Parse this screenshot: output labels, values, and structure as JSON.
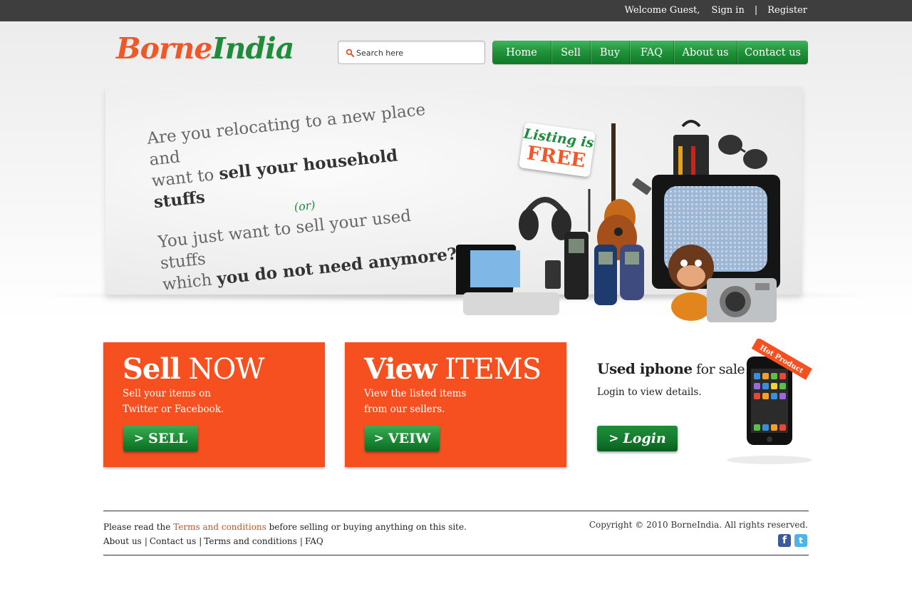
{
  "topbar": {
    "welcome": "Welcome Guest,",
    "signin": "Sign in",
    "separator": "|",
    "register": "Register"
  },
  "logo": {
    "part1": "Borne",
    "part2": "India"
  },
  "search": {
    "placeholder": "Search here"
  },
  "nav": {
    "items": [
      {
        "label": "Home"
      },
      {
        "label": "Sell"
      },
      {
        "label": "Buy"
      },
      {
        "label": "FAQ"
      },
      {
        "label": "About us"
      },
      {
        "label": "Contact us"
      }
    ]
  },
  "hero": {
    "line1": "Are you relocating to a new place and",
    "line2_plain": "want to ",
    "line2_bold": "sell your household stuffs",
    "or": "(or)",
    "line3": "You just want to sell your used stuffs",
    "line4_plain": "which ",
    "line4_bold": "you do not need anymore?",
    "badge_line1": "Listing is",
    "badge_line2": "FREE"
  },
  "sell_box": {
    "title_bold": "Sell",
    "title_rest": " NOW",
    "desc_line1": "Sell your items on",
    "desc_line2": "Twitter or Facebook.",
    "button": "SELL"
  },
  "view_box": {
    "title_bold": "View",
    "title_rest": " ITEMS",
    "desc_line1": "View the listed items",
    "desc_line2": "from our sellers.",
    "button": "VEIW"
  },
  "promo": {
    "title_bold": "Used iphone",
    "title_rest": " for sale!!",
    "desc": "Login to view details.",
    "button": "Login",
    "ribbon": "Hot Product"
  },
  "footer": {
    "notice_before": "Please read the ",
    "notice_link": "Terms and conditions",
    "notice_after": " before selling or buying anything on this site.",
    "links": [
      "About us",
      "Contact us",
      "Terms and conditions",
      "FAQ"
    ],
    "pipe": "|",
    "copyright": "Copyright © 2010 BorneIndia. All rights reserved."
  },
  "colors": {
    "orange": "#f65021",
    "green": "#1e8c3a",
    "topbar": "#3e3e3e"
  },
  "icons": {
    "search": "search-icon",
    "chevron": ">",
    "facebook": "f",
    "twitter": "t"
  }
}
